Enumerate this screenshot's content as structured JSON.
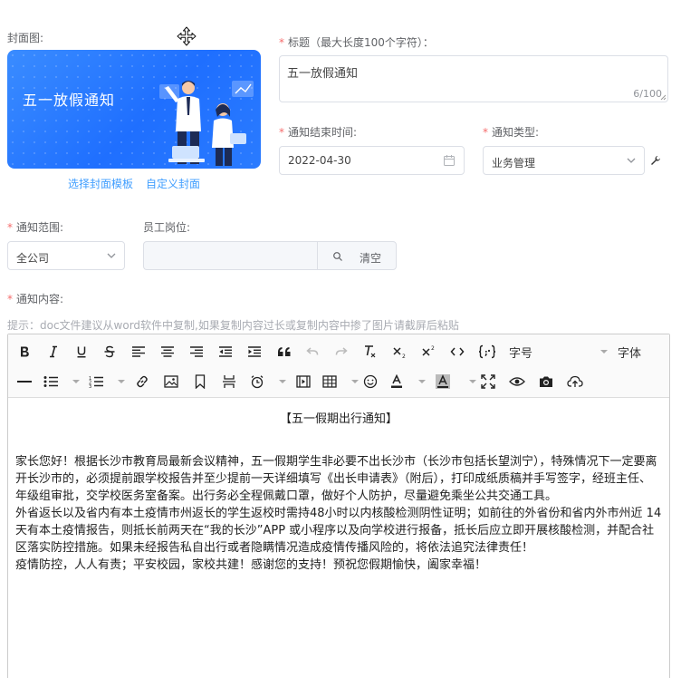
{
  "cover": {
    "label": "封面图:",
    "title": "五一放假通知",
    "link_template": "选择封面模板",
    "link_custom": "自定义封面"
  },
  "title_field": {
    "label": "标题（最大长度100个字符）：",
    "value": "五一放假通知",
    "count": "6/100"
  },
  "end_time": {
    "label": "通知结束时间:",
    "value": "2022-04-30"
  },
  "notice_type": {
    "label": "通知类型:",
    "value": "业务管理"
  },
  "scope": {
    "label": "通知范围:",
    "value": "全公司"
  },
  "post": {
    "label": "员工岗位:",
    "clear_label": "清空"
  },
  "content_field": {
    "label": "通知内容:",
    "hint": "提示：doc文件建议从word软件中复制,如果复制内容过长或复制内容中掺了图片请截屏后粘贴"
  },
  "toolbar": {
    "heading_select": "字号",
    "font_select": "字体"
  },
  "content": {
    "heading": "【五一假期出行通知】",
    "paragraphs": [
      "家长您好！根据长沙市教育局最新会议精神，五一假期学生非必要不出长沙市（长沙市包括长望浏宁），特殊情况下一定要离开长沙市的，必须提前跟学校报告并至少提前一天详细填写《出长申请表》（附后），打印成纸质稿并手写签字，经班主任、年级组审批，交学校医务室备案。出行务必全程佩戴口罩，做好个人防护，尽量避免乘坐公共交通工具。",
      "外省返长以及省内有本土疫情市州返长的学生返校时需持48小时以内核酸检测阴性证明；如前往的外省份和省内外市州近 14 天有本土疫情报告，则抵长前两天在“我的长沙”APP 或小程序以及向学校进行报备，抵长后应立即开展核酸检测，并配合社区落实防控措施。如果未经报告私自出行或者隐瞒情况造成疫情传播风险的，将依法追究法律责任！",
      "疫情防控，人人有责；平安校园，家校共建！感谢您的支持！预祝您假期愉快，阖家幸福！"
    ]
  },
  "colors": {
    "accent": "#409eff",
    "cover_bg": "#2a7bff",
    "required": "#f56c6c"
  }
}
